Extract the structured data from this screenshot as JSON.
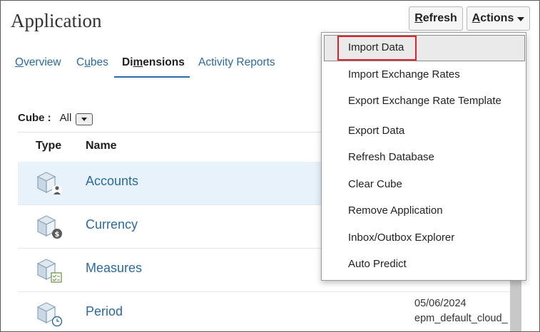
{
  "header": {
    "title": "Application",
    "refresh_prefix": "R",
    "refresh_rest": "efresh",
    "actions_prefix": "A",
    "actions_rest": "ctions"
  },
  "tabs": [
    {
      "label_a": "O",
      "label_b": "verview",
      "active": false
    },
    {
      "label_a": "C",
      "label_u": "u",
      "label_b": "bes",
      "active": false
    },
    {
      "label_a": "Di",
      "label_u": "m",
      "label_b": "ensions",
      "active": true
    },
    {
      "label_a": "",
      "label_u": "",
      "label_b": "Activity Reports",
      "active": false
    }
  ],
  "filter": {
    "label": "Cube :",
    "value": "All"
  },
  "table": {
    "columns": [
      "Type",
      "Name"
    ],
    "rows": [
      {
        "name": "Accounts",
        "icon": "accounts-dimension-icon",
        "selected": true,
        "meta1": "",
        "meta2": ""
      },
      {
        "name": "Currency",
        "icon": "currency-dimension-icon",
        "selected": false,
        "meta1": "",
        "meta2": ""
      },
      {
        "name": "Measures",
        "icon": "measures-dimension-icon",
        "selected": false,
        "meta1": "",
        "meta2": ""
      },
      {
        "name": "Period",
        "icon": "period-dimension-icon",
        "selected": false,
        "meta1": "05/06/2024",
        "meta2": "epm_default_cloud_"
      }
    ]
  },
  "actions_menu": {
    "items": [
      "Import Data",
      "Import Exchange Rates",
      "Export Exchange Rate Template",
      "Export Data",
      "Refresh Database",
      "Clear Cube",
      "Remove Application",
      "Inbox/Outbox Explorer",
      "Auto Predict"
    ],
    "highlighted": "Import Data"
  },
  "colors": {
    "link": "#2b6aa0",
    "selected_row": "#e8f2fb",
    "annotation": "#e2202a"
  }
}
